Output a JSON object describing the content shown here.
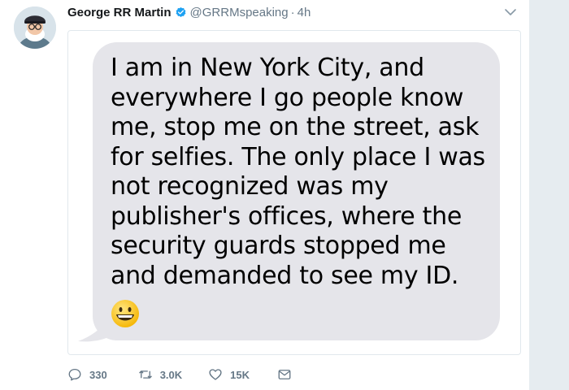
{
  "tweet": {
    "author_name": "George RR Martin",
    "handle": "@GRRMspeaking",
    "separator": "·",
    "time": "4h",
    "verified": true,
    "image_text": "I am in New York City, and\neverywhere I go people know\nme, stop me on the street, ask\nfor selfies. The only place I was\nnot recognized was my\npublisher's offices, where the\nsecurity guards stopped me\nand demanded to see my ID.",
    "image_emoji": "grinning-face-emoji",
    "actions": {
      "reply_count": "330",
      "retweet_count": "3.0K",
      "like_count": "15K"
    }
  },
  "colors": {
    "name": "#14171a",
    "secondary": "#657786",
    "verified": "#1da1f2",
    "bubble": "#e5e5ea",
    "page_background": "#e6ecf0"
  },
  "icons": [
    "verified-badge-icon",
    "chevron-down-icon",
    "reply-icon",
    "retweet-icon",
    "like-icon",
    "direct-message-icon"
  ]
}
